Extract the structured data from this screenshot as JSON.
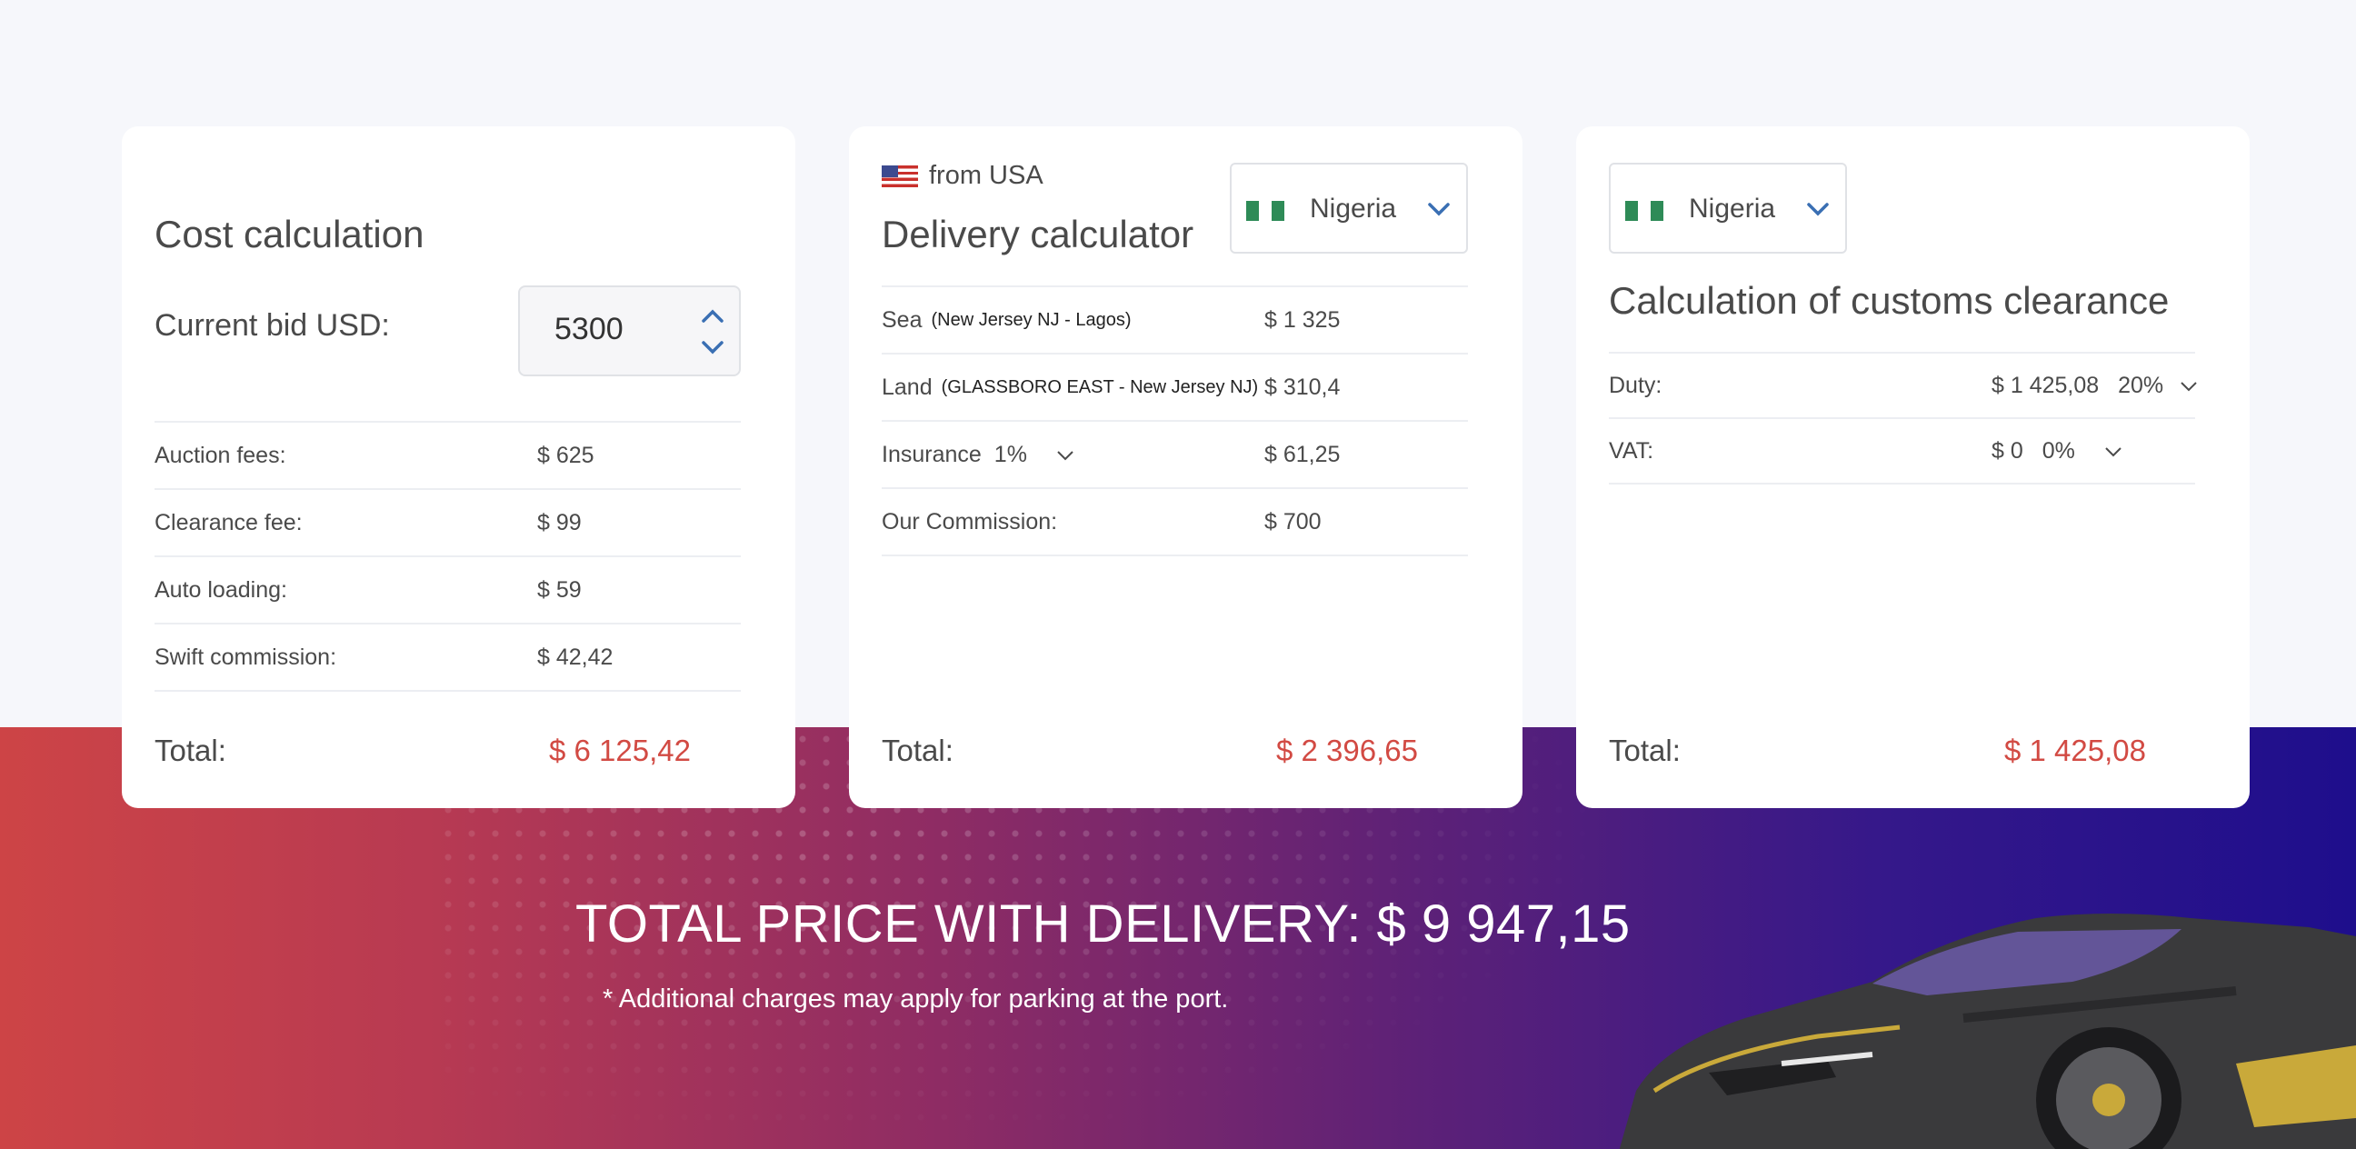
{
  "cost_card": {
    "title": "Cost calculation",
    "bid_label": "Current bid USD:",
    "bid_value": "5300",
    "rows": [
      {
        "label": "Auction fees:",
        "value": "$ 625"
      },
      {
        "label": "Clearance fee:",
        "value": "$ 99"
      },
      {
        "label": "Auto loading:",
        "value": "$ 59"
      },
      {
        "label": "Swift commission:",
        "value": "$ 42,42"
      }
    ],
    "total_label": "Total:",
    "total_value": "$ 6 125,42"
  },
  "delivery_card": {
    "from_label": "from USA",
    "title": "Delivery calculator",
    "country": "Nigeria",
    "rows": [
      {
        "label": "Sea",
        "sub": "(New Jersey NJ - Lagos)",
        "value": "$ 1 325"
      },
      {
        "label": "Land",
        "sub": "(GLASSBORO EAST - New Jersey NJ)",
        "value": "$ 310,4"
      },
      {
        "label": "Insurance",
        "select": "1%",
        "value": "$ 61,25"
      },
      {
        "label": "Our Commission:",
        "value": "$ 700"
      }
    ],
    "total_label": "Total:",
    "total_value": "$ 2 396,65"
  },
  "customs_card": {
    "country": "Nigeria",
    "title": "Calculation of customs clearance",
    "rows": [
      {
        "label": "Duty:",
        "value": "$ 1 425,08",
        "select": "20%"
      },
      {
        "label": "VAT:",
        "value": "$ 0",
        "select": "0%"
      }
    ],
    "total_label": "Total:",
    "total_value": "$ 1 425,08"
  },
  "banner": {
    "total_price": "TOTAL PRICE WITH DELIVERY: $ 9 947,15",
    "note": "* Additional charges may apply for parking at the port."
  },
  "colors": {
    "accent_red": "#d24a43",
    "chevron_blue": "#3a6fb3",
    "nigeria_green": "#2e8b57"
  },
  "icons": [
    "us-flag-icon",
    "nigeria-flag-icon",
    "chevron-down-icon",
    "chevron-up-icon"
  ]
}
